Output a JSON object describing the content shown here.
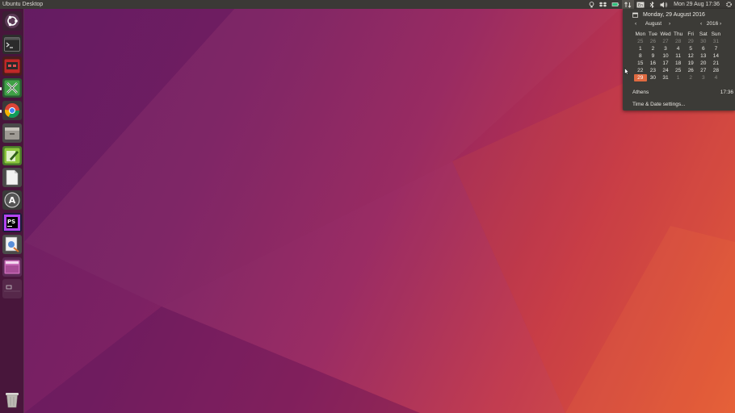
{
  "panel": {
    "title": "Ubuntu Desktop",
    "clock": "Mon 29 Aug 17:36",
    "indicators": [
      "bulb-icon",
      "dropbox-icon",
      "battery-icon",
      "network-icon",
      "keyboard-icon",
      "bluetooth-icon",
      "volume-icon",
      "gear-icon"
    ]
  },
  "launcher": {
    "items": [
      {
        "name": "dash-button",
        "icon": "ubuntu-logo-icon"
      },
      {
        "name": "terminal-launcher",
        "icon": "terminal-icon"
      },
      {
        "name": "screen-recorder-launcher",
        "icon": "record-icon"
      },
      {
        "name": "xmind-launcher",
        "icon": "xmind-icon"
      },
      {
        "name": "chrome-launcher",
        "icon": "chrome-icon"
      },
      {
        "name": "files-launcher",
        "icon": "files-icon"
      },
      {
        "name": "text-editor-launcher",
        "icon": "editor-icon"
      },
      {
        "name": "document-launcher",
        "icon": "document-icon"
      },
      {
        "name": "software-updater-launcher",
        "icon": "updater-icon"
      },
      {
        "name": "phpstorm-launcher",
        "icon": "phpstorm-icon"
      },
      {
        "name": "image-viewer-launcher",
        "icon": "image-viewer-icon"
      },
      {
        "name": "workspace-switcher-launcher",
        "icon": "workspace-icon"
      },
      {
        "name": "window-launcher",
        "icon": "window-icon"
      }
    ],
    "trash_icon": "trash-icon",
    "phpstorm_label": "PS"
  },
  "calendar": {
    "full_date": "Monday, 29 August 2016",
    "month": "August",
    "year": "2016",
    "prev_month": "‹",
    "next_month": "›",
    "prev_year": "‹",
    "next_year": "›",
    "weekdays": [
      "Mon",
      "Tue",
      "Wed",
      "Thu",
      "Fri",
      "Sat",
      "Sun"
    ],
    "weeks": [
      [
        {
          "d": "25",
          "dim": true
        },
        {
          "d": "26",
          "dim": true
        },
        {
          "d": "27",
          "dim": true
        },
        {
          "d": "28",
          "dim": true
        },
        {
          "d": "29",
          "dim": true
        },
        {
          "d": "30",
          "dim": true
        },
        {
          "d": "31",
          "dim": true
        }
      ],
      [
        {
          "d": "1"
        },
        {
          "d": "2"
        },
        {
          "d": "3"
        },
        {
          "d": "4"
        },
        {
          "d": "5"
        },
        {
          "d": "6"
        },
        {
          "d": "7"
        }
      ],
      [
        {
          "d": "8"
        },
        {
          "d": "9"
        },
        {
          "d": "10"
        },
        {
          "d": "11"
        },
        {
          "d": "12"
        },
        {
          "d": "13"
        },
        {
          "d": "14"
        }
      ],
      [
        {
          "d": "15"
        },
        {
          "d": "16"
        },
        {
          "d": "17"
        },
        {
          "d": "18"
        },
        {
          "d": "19"
        },
        {
          "d": "20"
        },
        {
          "d": "21"
        }
      ],
      [
        {
          "d": "22"
        },
        {
          "d": "23"
        },
        {
          "d": "24"
        },
        {
          "d": "25"
        },
        {
          "d": "26"
        },
        {
          "d": "27"
        },
        {
          "d": "28"
        }
      ],
      [
        {
          "d": "29",
          "today": true
        },
        {
          "d": "30"
        },
        {
          "d": "31"
        },
        {
          "d": "1",
          "dim": true
        },
        {
          "d": "2",
          "dim": true
        },
        {
          "d": "3",
          "dim": true
        },
        {
          "d": "4",
          "dim": true
        }
      ]
    ],
    "location": "Athens",
    "location_time": "17:36",
    "settings_label": "Time & Date settings..."
  },
  "colors": {
    "panel_bg": "#3b3936",
    "menu_bg": "#3c3b37",
    "today_accent": "#e06a40"
  }
}
